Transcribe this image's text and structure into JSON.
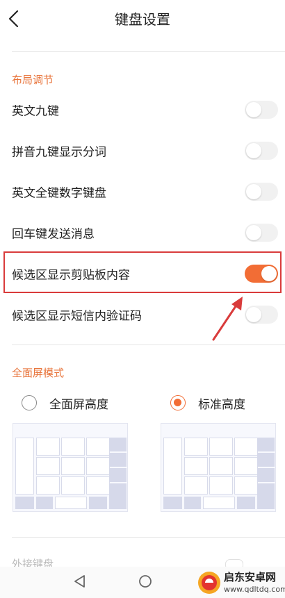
{
  "header": {
    "title": "键盘设置",
    "back_icon": "chevron-left-icon"
  },
  "layout_section": {
    "title": "布局调节",
    "items": [
      {
        "label": "英文九键",
        "enabled": false
      },
      {
        "label": "拼音九键显示分词",
        "enabled": false
      },
      {
        "label": "英文全键数字键盘",
        "enabled": false
      },
      {
        "label": "回车键发送消息",
        "enabled": false
      },
      {
        "label": "候选区显示剪贴板内容",
        "enabled": true
      },
      {
        "label": "候选区显示短信内验证码",
        "enabled": false
      }
    ]
  },
  "fullscreen_section": {
    "title": "全面屏模式",
    "options": [
      {
        "label": "全面屏高度",
        "selected": false
      },
      {
        "label": "标准高度",
        "selected": true
      }
    ]
  },
  "partial_section": {
    "title": "外接键盘"
  },
  "nav_bar": {
    "back_icon": "triangle-back-icon",
    "home_icon": "circle-home-icon"
  },
  "watermark": {
    "title": "启东安卓网",
    "url": "www.qdltdq.com"
  },
  "colors": {
    "accent": "#f26d35",
    "section": "#e8743b",
    "highlight_border": "#d93b3b",
    "toggle_off": "#f1f1f1"
  }
}
